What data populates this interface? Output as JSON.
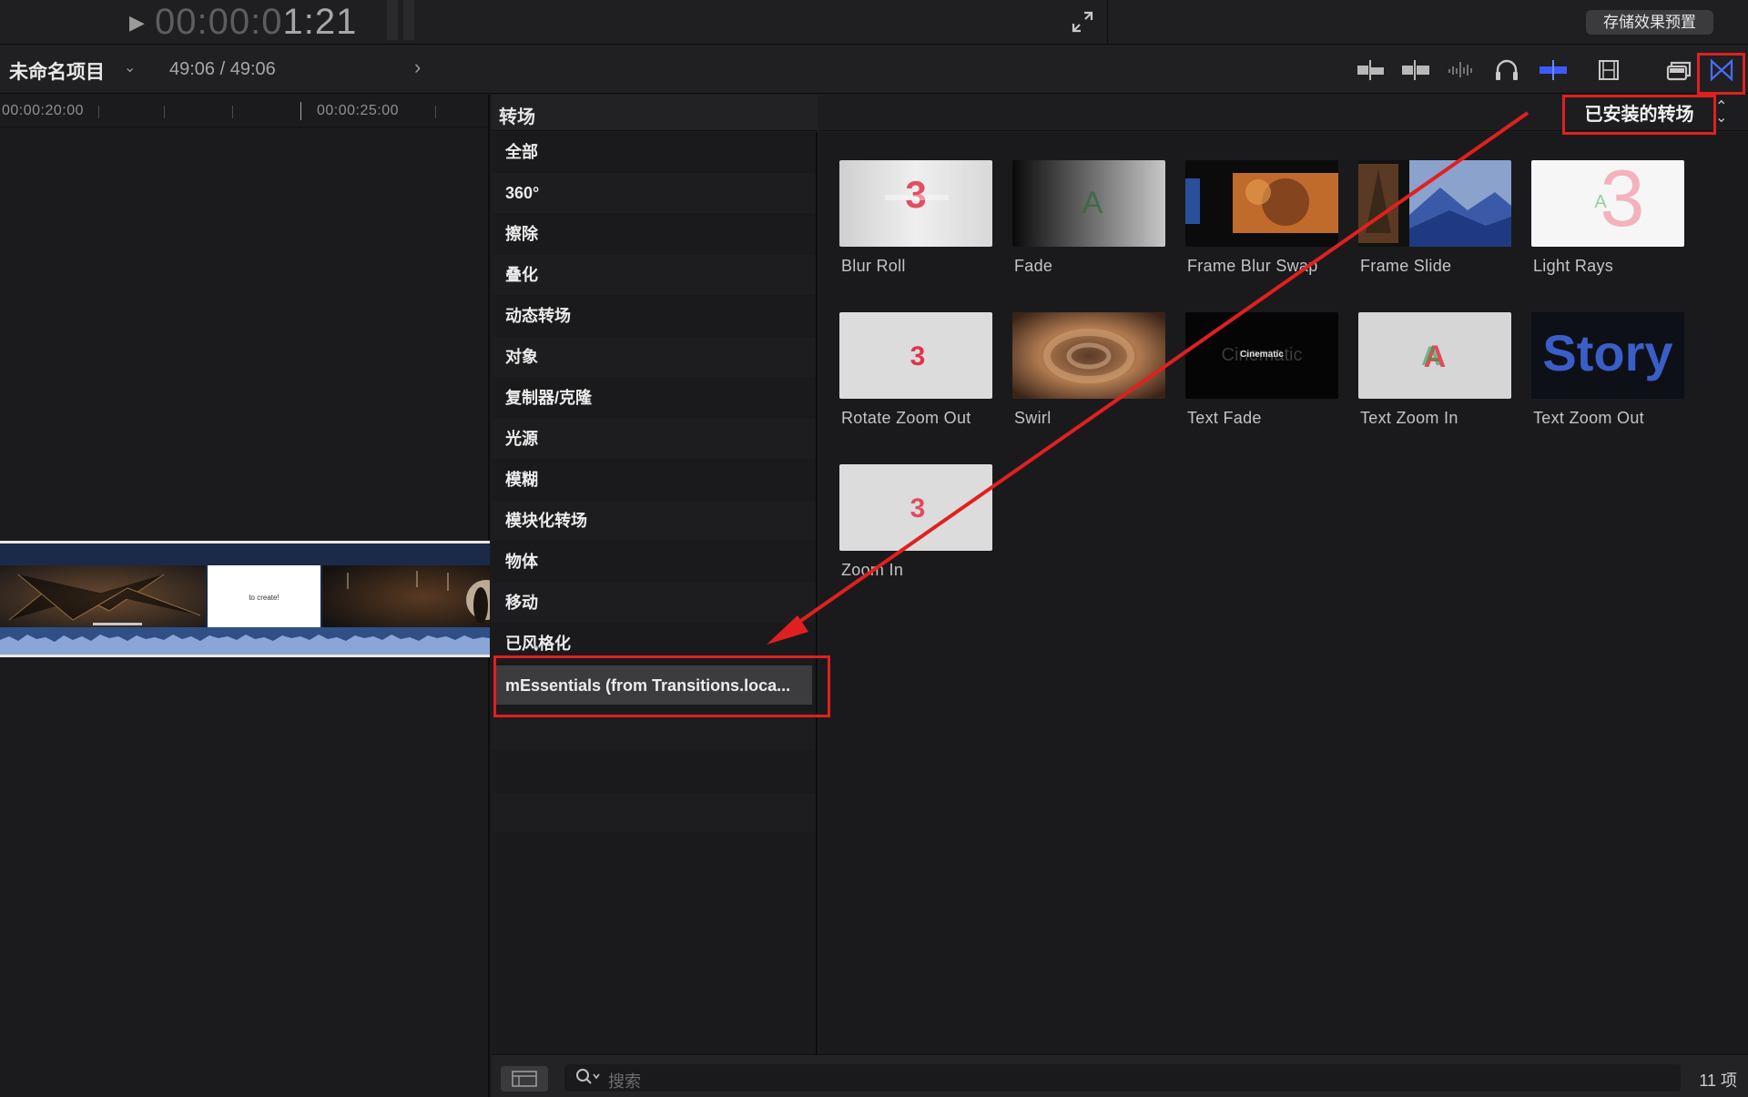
{
  "viewer": {
    "play_icon": "play-icon",
    "timecode_dim": "00:00:0",
    "timecode_bright": "1:21",
    "save_preset_label": "存储效果预置"
  },
  "toolbar": {
    "project_name": "未命名项目",
    "duration": "49:06 / 49:06",
    "icons": [
      "append-clip-icon",
      "insert-clip-icon",
      "audio-waveform-icon",
      "headphones-icon",
      "skimming-icon",
      "filmstrip-icon",
      "effects-browser-icon",
      "transitions-browser-icon"
    ]
  },
  "timeline": {
    "ruler": [
      "00:00:20:00",
      "00:00:25:00"
    ],
    "clip_caption": "to create!"
  },
  "browser": {
    "sidebar_title": "转场",
    "categories": [
      "全部",
      "360°",
      "擦除",
      "叠化",
      "动态转场",
      "对象",
      "复制器/克隆",
      "光源",
      "模糊",
      "模块化转场",
      "物体",
      "移动",
      "已风格化",
      "mEssentials (from Transitions.loca..."
    ],
    "selected_category": "mEssentials (from Transitions.loca...",
    "installed_label": "已安装的转场",
    "tiles": [
      {
        "label": "Blur Roll",
        "thumb": "blur-roll"
      },
      {
        "label": "Fade",
        "thumb": "fade"
      },
      {
        "label": "Frame Blur Swap",
        "thumb": "frame-blur-swap"
      },
      {
        "label": "Frame Slide",
        "thumb": "frame-slide"
      },
      {
        "label": "Light Rays",
        "thumb": "light-rays"
      },
      {
        "label": "Rotate Zoom Out",
        "thumb": "rotate-zoom-out"
      },
      {
        "label": "Swirl",
        "thumb": "swirl"
      },
      {
        "label": "Text Fade",
        "thumb": "text-fade",
        "thumb_text": "Cinematic"
      },
      {
        "label": "Text Zoom In",
        "thumb": "text-zoom-in"
      },
      {
        "label": "Text Zoom Out",
        "thumb": "text-zoom-out",
        "thumb_text": "Story"
      },
      {
        "label": "Zoom In",
        "thumb": "zoom-in"
      }
    ],
    "search_placeholder": "搜索",
    "item_count": "11 项"
  },
  "colors": {
    "annotation_red": "#e02020",
    "accent_blue": "#3d5afe"
  }
}
